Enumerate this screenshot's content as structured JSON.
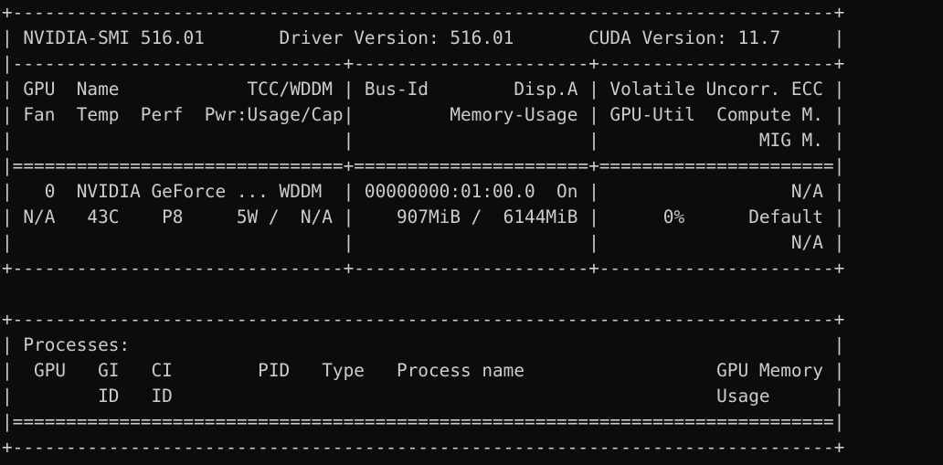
{
  "terminal": {
    "background": "#0c0c0c",
    "foreground": "#cccccc",
    "lines": [
      "+-----------------------------------------------------------------------------+",
      "| NVIDIA-SMI 516.01       Driver Version: 516.01       CUDA Version: 11.7     |",
      "|-------------------------------+----------------------+----------------------+",
      "| GPU  Name            TCC/WDDM | Bus-Id        Disp.A | Volatile Uncorr. ECC |",
      "| Fan  Temp  Perf  Pwr:Usage/Cap|         Memory-Usage | GPU-Util  Compute M. |",
      "|                               |                      |               MIG M. |",
      "|===============================+======================+======================|",
      "|   0  NVIDIA GeForce ... WDDM  | 00000000:01:00.0  On |                  N/A |",
      "| N/A   43C    P8     5W /  N/A |    907MiB /  6144MiB |      0%      Default |",
      "|                               |                      |                  N/A |",
      "+-------------------------------+----------------------+----------------------+",
      "",
      "",
      "+-----------------------------------------------------------------------------+",
      "| Processes:                                                                  |",
      "|  GPU   GI   CI        PID   Type   Process name                  GPU Memory |",
      "|        ID   ID                                                   Usage      |",
      "|=============================================================================|",
      "+-----------------------------------------------------------------------------+"
    ]
  }
}
